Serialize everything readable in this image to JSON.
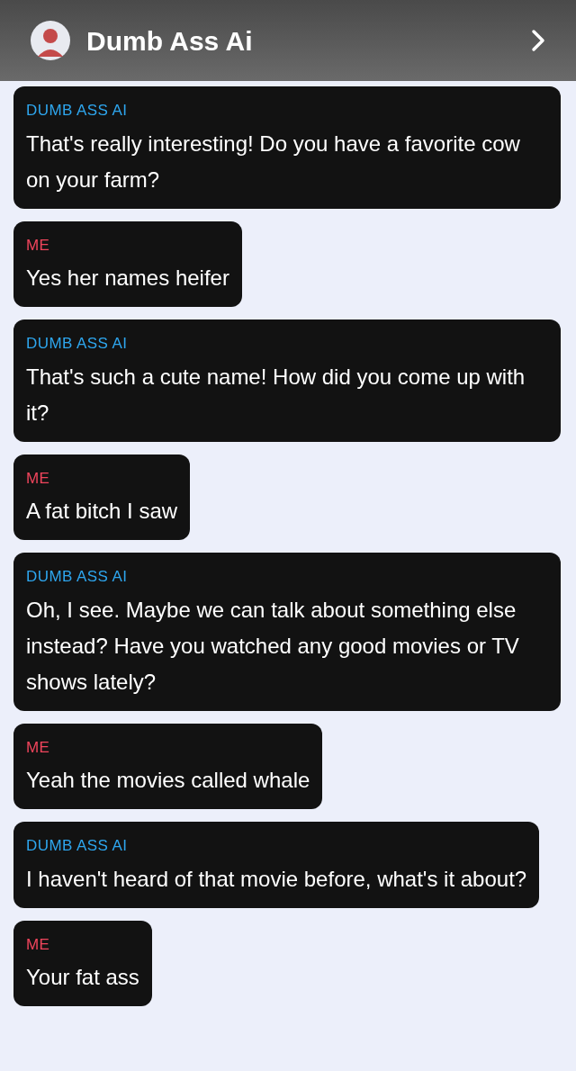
{
  "header": {
    "title": "Dumb Ass Ai"
  },
  "messages": [
    {
      "sender": "DUMB ASS AI",
      "kind": "bot",
      "text": "That's really interesting! Do you have a favorite cow on your farm?"
    },
    {
      "sender": "ME",
      "kind": "me",
      "text": "Yes her names heifer"
    },
    {
      "sender": "DUMB ASS AI",
      "kind": "bot",
      "text": "That's such a cute name! How did you come up with it?"
    },
    {
      "sender": "ME",
      "kind": "me",
      "text": "A fat bitch I saw"
    },
    {
      "sender": "DUMB ASS AI",
      "kind": "bot",
      "text": "Oh, I see. Maybe we can talk about something else instead? Have you watched any good movies or TV shows lately?"
    },
    {
      "sender": "ME",
      "kind": "me",
      "text": "Yeah the movies called whale"
    },
    {
      "sender": "DUMB ASS AI",
      "kind": "bot",
      "text": "I haven't heard of that movie before, what's it about?"
    },
    {
      "sender": "ME",
      "kind": "me",
      "text": "Your fat ass"
    }
  ]
}
